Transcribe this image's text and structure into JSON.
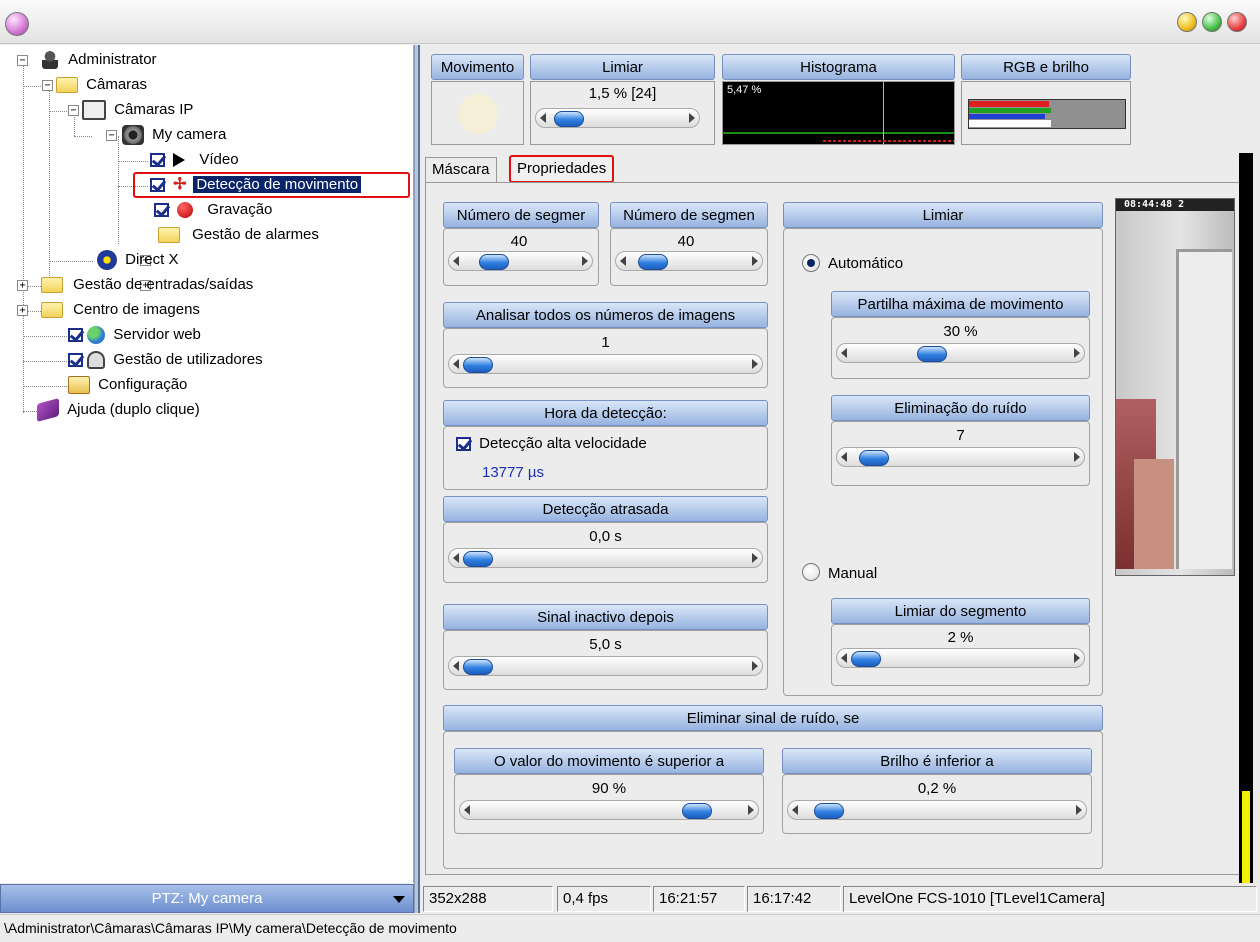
{
  "window": {
    "title": ""
  },
  "tree": {
    "administrator": "Administrator",
    "cameras": "Câmaras",
    "ip_cameras": "Câmaras IP",
    "my_camera": "My camera",
    "video": "Vídeo",
    "motion_detection": "Detecção de movimento",
    "recording": "Gravação",
    "alarm_management": "Gestão de alarmes",
    "direct_x": "Direct X",
    "io_management": "Gestão de entradas/saídas",
    "image_center": "Centro de imagens",
    "web_server": "Servidor web",
    "user_management": "Gestão de utilizadores",
    "configuration": "Configuração",
    "help": "Ajuda (duplo clique)"
  },
  "ptz": {
    "label": "PTZ: My camera"
  },
  "top_panels": {
    "movement": "Movimento",
    "threshold": "Limiar",
    "threshold_value": "1,5 % [24]",
    "threshold_level": 0.15,
    "histogram": "Histograma",
    "histogram_value": "5,47 %",
    "rgb": "RGB e brilho"
  },
  "tabs": {
    "mask": "Máscara",
    "properties": "Propriedades"
  },
  "segments": {
    "seg1_label": "Número de segmer",
    "seg1_value": "40",
    "seg2_label": "Número de segmen",
    "seg2_value": "40"
  },
  "analyze": {
    "label": "Analisar todos os números de imagens",
    "value": "1"
  },
  "detection_time": {
    "label": "Hora da detecção:",
    "checkbox": "Detecção alta velocidade",
    "value": "13777 µs"
  },
  "delayed": {
    "label": "Detecção atrasada",
    "value": "0,0 s"
  },
  "inactive": {
    "label": "Sinal inactivo depois",
    "value": "5,0 s"
  },
  "threshold_group": {
    "label": "Limiar",
    "automatic": "Automático",
    "max_share_label": "Partilha máxima de movimento",
    "max_share_value": "30 %",
    "noise_label": "Eliminação do ruído",
    "noise_value": "7",
    "manual": "Manual",
    "segment_label": "Limiar do segmento",
    "segment_value": "2 %"
  },
  "noise_signal": {
    "label": "Eliminar sinal de ruído, se",
    "motion_label": "O valor do movimento é superior a",
    "motion_value": "90 %",
    "brightness_label": "Brilho é inferior a",
    "brightness_value": "0,2 %"
  },
  "camera_preview": {
    "timestamp": "08:44:48 2"
  },
  "status": {
    "resolution": "352x288",
    "fps": "0,4 fps",
    "time1": "16:21:57",
    "time2": "16:17:42",
    "camera": "LevelOne FCS-1010 [TLevel1Camera]"
  },
  "path": "\\Administrator\\Câmaras\\Câmaras IP\\My camera\\Detecção de movimento",
  "colors": {
    "selection": "#0a246a",
    "highlight_box": "#e01010",
    "header_blue": "#97b3e0"
  }
}
